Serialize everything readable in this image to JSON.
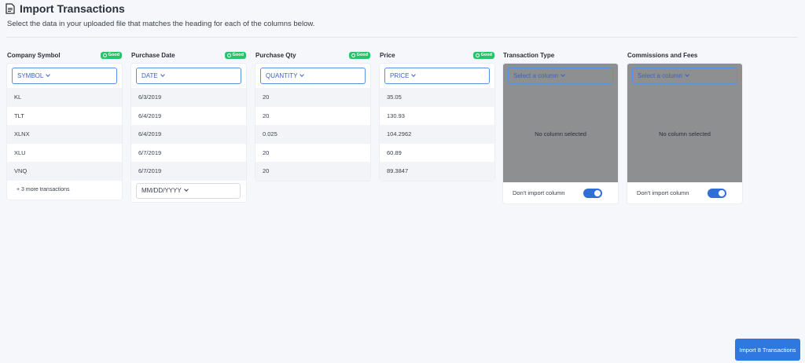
{
  "header": {
    "title": "Import Transactions",
    "subtitle": "Select the data in your uploaded file that matches the heading for each of the columns below."
  },
  "colors": {
    "accent": "#2f78e0",
    "good": "#27c468",
    "disabled_bg": "#8e8f90"
  },
  "columns": [
    {
      "title": "Company Symbol",
      "badge": "Good",
      "selected": "SYMBOL",
      "rows": [
        "KL",
        "TLT",
        "XLNX",
        "XLU",
        "VNQ"
      ],
      "more": "+ 3 more transactions"
    },
    {
      "title": "Purchase Date",
      "badge": "Good",
      "selected": "DATE",
      "rows": [
        "6/3/2019",
        "6/4/2019",
        "6/4/2019",
        "6/7/2019",
        "6/7/2019"
      ],
      "date_format": "MM/DD/YYYY"
    },
    {
      "title": "Purchase Qty",
      "badge": "Good",
      "selected": "QUANTITY",
      "rows": [
        "20",
        "20",
        "0.025",
        "20",
        "20"
      ]
    },
    {
      "title": "Price",
      "badge": "Good",
      "selected": "PRICE",
      "rows": [
        "35.05",
        "130.93",
        "104.2962",
        "60.89",
        "89.3847"
      ]
    },
    {
      "title": "Transaction Type",
      "selected_placeholder": "Select a column",
      "empty_text": "No column selected",
      "toggle_label": "Don't import column",
      "toggle_on": true
    },
    {
      "title": "Commissions and Fees",
      "selected_placeholder": "Select a column",
      "empty_text": "No column selected",
      "toggle_label": "Don't import column",
      "toggle_on": true
    }
  ],
  "footer": {
    "import_label": "Import 8 Transactions"
  }
}
